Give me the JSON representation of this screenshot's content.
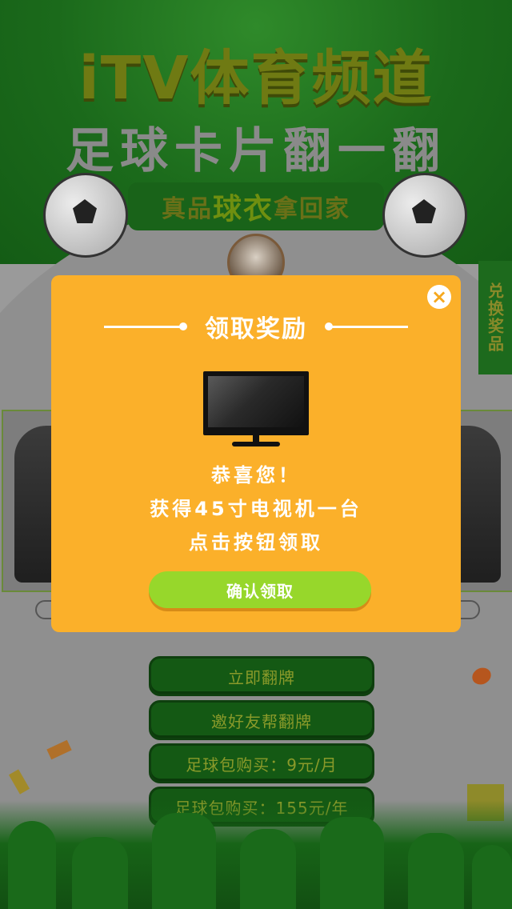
{
  "header": {
    "title": "iTV体育频道",
    "subtitle": "足球卡片翻一翻",
    "banner_pre": "真品",
    "banner_highlight": "球衣",
    "banner_post": "拿回家"
  },
  "side_tab": {
    "label": "兑换奖品"
  },
  "actions": {
    "flip_now": "立即翻牌",
    "invite_friends": "邀好友帮翻牌",
    "monthly_pack": "足球包购买：9元/月",
    "yearly_pack": "足球包购买：155元/年"
  },
  "modal": {
    "title": "领取奖励",
    "line1": "恭喜您！",
    "line2": "获得45寸电视机一台",
    "line3": "点击按钮领取",
    "confirm_label": "确认领取",
    "close_icon": "×"
  },
  "colors": {
    "modal_bg": "#fbb02a",
    "confirm_bg": "#97d72b",
    "header_green": "#1b6a1b"
  }
}
